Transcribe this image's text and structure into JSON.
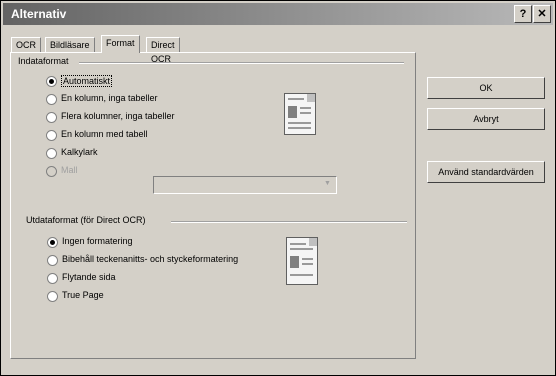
{
  "window": {
    "title": "Alternativ",
    "help_btn": "?",
    "close_btn": "✕"
  },
  "tabs": [
    {
      "label": "OCR"
    },
    {
      "label": "Bildläsare"
    },
    {
      "label": "Format"
    },
    {
      "label": "Direct OCR"
    }
  ],
  "input_format": {
    "label": "Indataformat",
    "options": [
      {
        "label": "Automatiskt",
        "selected": true
      },
      {
        "label": "En kolumn, inga tabeller",
        "selected": false
      },
      {
        "label": "Flera kolumner, inga tabeller",
        "selected": false
      },
      {
        "label": "En kolumn med tabell",
        "selected": false
      },
      {
        "label": "Kalkylark",
        "selected": false
      },
      {
        "label": "Mall",
        "selected": false,
        "disabled": true
      }
    ],
    "template_value": ""
  },
  "output_format": {
    "label": "Utdataformat (för Direct OCR)",
    "options": [
      {
        "label": "Ingen formatering",
        "selected": true
      },
      {
        "label": "Bibehåll teckenanitts- och styckeformatering",
        "selected": false
      },
      {
        "label": "Flytande sida",
        "selected": false
      },
      {
        "label": "True Page",
        "selected": false
      }
    ]
  },
  "buttons": {
    "ok": "OK",
    "cancel": "Avbryt",
    "defaults": "Använd standardvärden"
  }
}
